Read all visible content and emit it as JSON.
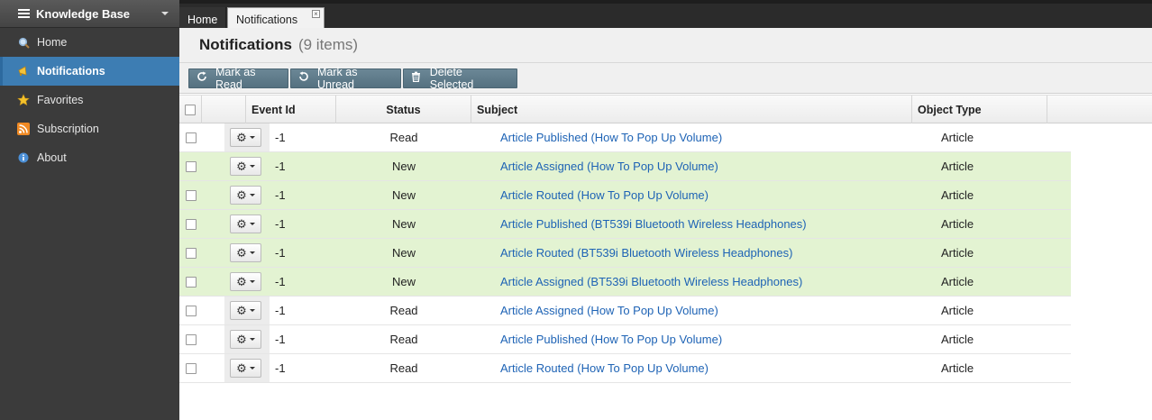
{
  "sidebar": {
    "title": "Knowledge Base",
    "items": [
      {
        "label": "Home",
        "icon": "search-icon",
        "active": false
      },
      {
        "label": "Notifications",
        "icon": "megaphone-icon",
        "active": true
      },
      {
        "label": "Favorites",
        "icon": "star-icon",
        "active": false
      },
      {
        "label": "Subscription",
        "icon": "rss-icon",
        "active": false
      },
      {
        "label": "About",
        "icon": "info-icon",
        "active": false
      }
    ]
  },
  "tabs": [
    {
      "label": "Home"
    },
    {
      "label": "Notifications"
    }
  ],
  "page": {
    "title": "Notifications",
    "count": "(9 items)"
  },
  "toolbar": {
    "mark_read": "Mark as Read",
    "mark_unread": "Mark as Unread",
    "delete": "Delete Selected"
  },
  "columns": {
    "event_id": "Event Id",
    "status": "Status",
    "subject": "Subject",
    "object_type": "Object Type"
  },
  "rows": [
    {
      "event_id": "-1",
      "status": "Read",
      "subject": "Article Published (How To Pop Up Volume)",
      "object_type": "Article"
    },
    {
      "event_id": "-1",
      "status": "New",
      "subject": "Article Assigned (How To Pop Up Volume)",
      "object_type": "Article"
    },
    {
      "event_id": "-1",
      "status": "New",
      "subject": "Article Routed (How To Pop Up Volume)",
      "object_type": "Article"
    },
    {
      "event_id": "-1",
      "status": "New",
      "subject": "Article Published (BT539i Bluetooth Wireless Headphones)",
      "object_type": "Article"
    },
    {
      "event_id": "-1",
      "status": "New",
      "subject": "Article Routed (BT539i Bluetooth Wireless Headphones)",
      "object_type": "Article"
    },
    {
      "event_id": "-1",
      "status": "New",
      "subject": "Article Assigned (BT539i Bluetooth Wireless Headphones)",
      "object_type": "Article"
    },
    {
      "event_id": "-1",
      "status": "Read",
      "subject": "Article Assigned (How To Pop Up Volume)",
      "object_type": "Article"
    },
    {
      "event_id": "-1",
      "status": "Read",
      "subject": "Article Published (How To Pop Up Volume)",
      "object_type": "Article"
    },
    {
      "event_id": "-1",
      "status": "Read",
      "subject": "Article Routed (How To Pop Up Volume)",
      "object_type": "Article"
    }
  ],
  "colors": {
    "accent": "#3d7db3",
    "new_row": "#e3f3d2",
    "link": "#1e63b5",
    "button": "#5f7b8a"
  }
}
